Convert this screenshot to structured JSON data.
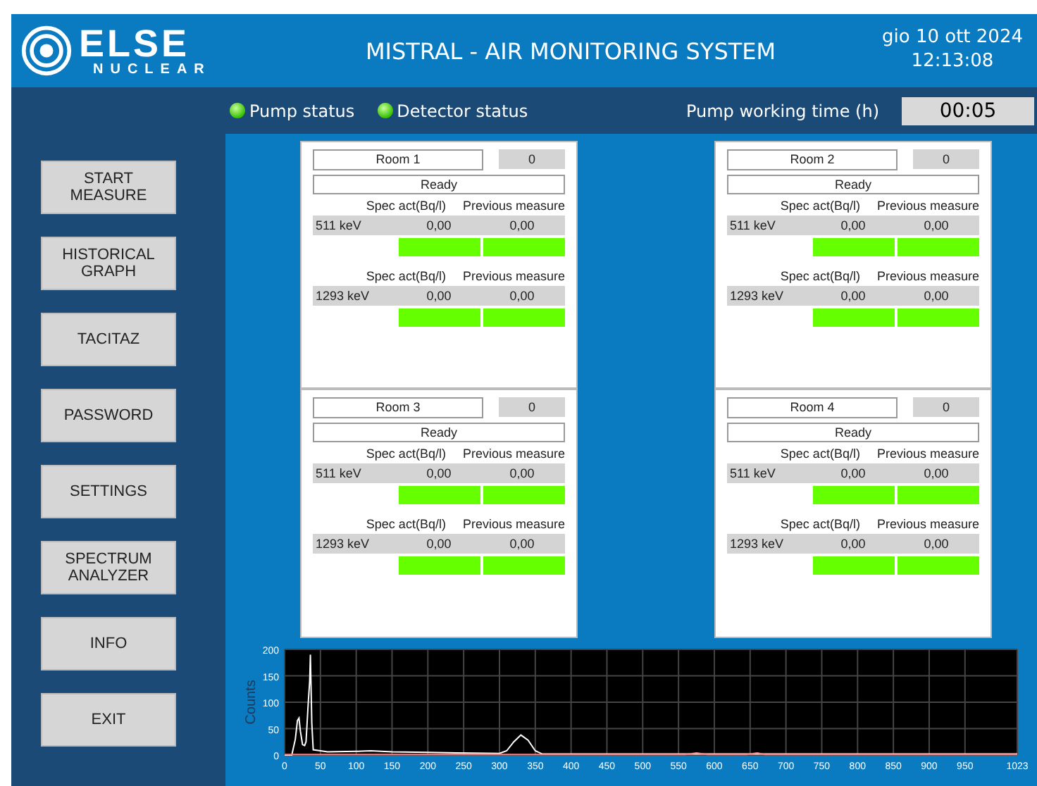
{
  "header": {
    "logo_top": "ELSE",
    "logo_bottom": "NUCLEAR",
    "title": "MISTRAL - AIR MONITORING SYSTEM",
    "date": "gio 10 ott 2024",
    "time": "12:13:08"
  },
  "status": {
    "indicators": [
      {
        "label": "Pump status",
        "on": true
      },
      {
        "label": "Detector status",
        "on": true
      }
    ],
    "pump_time_label": "Pump working time (h)",
    "pump_time": "00:05"
  },
  "menu": [
    "START MEASURE",
    "HISTORICAL GRAPH",
    "TACITAZ",
    "PASSWORD",
    "SETTINGS",
    "SPECTRUM ANALYZER",
    "INFO",
    "EXIT"
  ],
  "rooms": [
    {
      "name": "Room 1",
      "count": "0",
      "state": "Ready",
      "measures": [
        {
          "head_value": "Spec act(Bq/l)",
          "head_previous": "Previous measure",
          "energy": "511 keV",
          "value": "0,00",
          "previous": "0,00",
          "value_ok": true,
          "previous_ok": true
        },
        {
          "head_value": "Spec act(Bq/l)",
          "head_previous": "Previous measure",
          "energy": "1293 keV",
          "value": "0,00",
          "previous": "0,00",
          "value_ok": true,
          "previous_ok": true
        }
      ]
    },
    {
      "name": "Room 2",
      "count": "0",
      "state": "Ready",
      "measures": [
        {
          "head_value": "Spec act(Bq/l)",
          "head_previous": "Previous measure",
          "energy": "511 keV",
          "value": "0,00",
          "previous": "0,00",
          "value_ok": true,
          "previous_ok": true
        },
        {
          "head_value": "Spec act(Bq/l)",
          "head_previous": "Previous measure",
          "energy": "1293 keV",
          "value": "0,00",
          "previous": "0,00",
          "value_ok": true,
          "previous_ok": true
        }
      ]
    },
    {
      "name": "Room 3",
      "count": "0",
      "state": "Ready",
      "measures": [
        {
          "head_value": "Spec act(Bq/l)",
          "head_previous": "Previous measure",
          "energy": "511 keV",
          "value": "0,00",
          "previous": "0,00",
          "value_ok": true,
          "previous_ok": true
        },
        {
          "head_value": "Spec act(Bq/l)",
          "head_previous": "Previous measure",
          "energy": "1293 keV",
          "value": "0,00",
          "previous": "0,00",
          "value_ok": true,
          "previous_ok": true
        }
      ]
    },
    {
      "name": "Room 4",
      "count": "0",
      "state": "Ready",
      "measures": [
        {
          "head_value": "Spec act(Bq/l)",
          "head_previous": "Previous measure",
          "energy": "511 keV",
          "value": "0,00",
          "previous": "0,00",
          "value_ok": true,
          "previous_ok": true
        },
        {
          "head_value": "Spec act(Bq/l)",
          "head_previous": "Previous measure",
          "energy": "1293 keV",
          "value": "0,00",
          "previous": "0,00",
          "value_ok": true,
          "previous_ok": true
        }
      ]
    }
  ],
  "spectrum": {
    "chart_data": {
      "type": "line",
      "ylabel": "Counts",
      "xlim": [
        0,
        1023
      ],
      "ylim": [
        0,
        200
      ],
      "xticks": [
        0,
        50,
        100,
        150,
        200,
        250,
        300,
        350,
        400,
        450,
        500,
        550,
        600,
        650,
        700,
        750,
        800,
        850,
        900,
        950,
        1023
      ],
      "yticks": [
        0,
        50,
        100,
        150,
        200
      ],
      "grid": true,
      "x": [
        0,
        10,
        15,
        18,
        20,
        22,
        25,
        28,
        30,
        33,
        35,
        36,
        38,
        40,
        50,
        60,
        100,
        120,
        150,
        200,
        240,
        300,
        310,
        320,
        330,
        340,
        350,
        360,
        400,
        560,
        575,
        590,
        645,
        660,
        670,
        750,
        1023
      ],
      "series": [
        {
          "color": "#ffffff",
          "values": [
            0,
            0,
            30,
            65,
            70,
            45,
            20,
            18,
            25,
            100,
            140,
            190,
            60,
            10,
            8,
            6,
            7,
            8,
            6,
            5,
            4,
            3,
            8,
            25,
            38,
            28,
            8,
            2,
            2,
            2,
            2,
            2,
            2,
            2,
            2,
            2,
            2
          ]
        },
        {
          "color": "#ff8080",
          "values": [
            1,
            1,
            1,
            1,
            1,
            1,
            1,
            1,
            1,
            1,
            1,
            1,
            1,
            1,
            1,
            1,
            1,
            1,
            1,
            1,
            1,
            1,
            1,
            1,
            1,
            1,
            1,
            1,
            1,
            1,
            4,
            1,
            1,
            4,
            1,
            1,
            1
          ]
        }
      ]
    }
  }
}
